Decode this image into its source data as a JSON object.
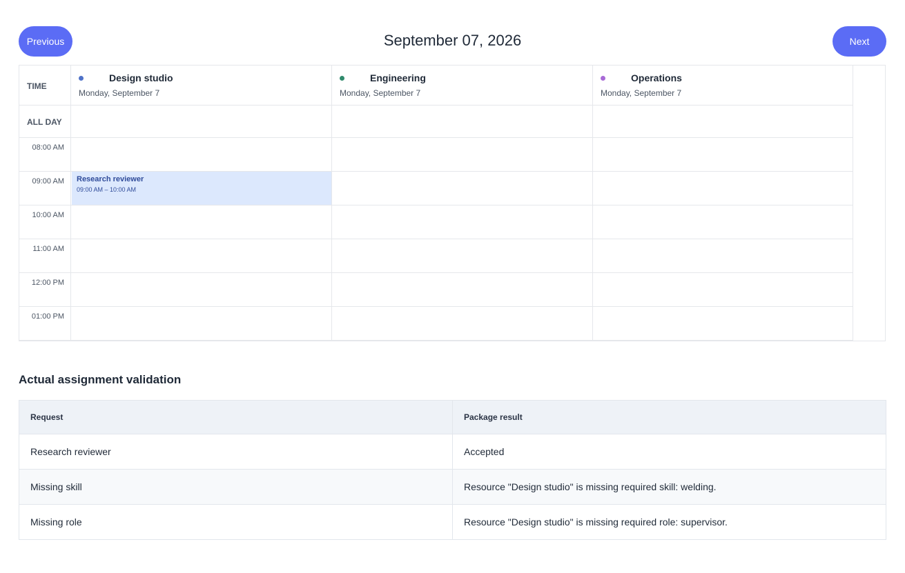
{
  "nav": {
    "previous_label": "Previous",
    "next_label": "Next",
    "current_date": "September 07, 2026"
  },
  "calendar": {
    "time_header": "TIME",
    "all_day_label": "ALL DAY",
    "resources": [
      {
        "name": "Design studio",
        "date": "Monday, September 7",
        "color": "#4f72c8"
      },
      {
        "name": "Engineering",
        "date": "Monday, September 7",
        "color": "#2f8a6c"
      },
      {
        "name": "Operations",
        "date": "Monday, September 7",
        "color": "#a86ad6"
      }
    ],
    "times": [
      "08:00 AM",
      "09:00 AM",
      "10:00 AM",
      "11:00 AM",
      "12:00 PM",
      "01:00 PM"
    ],
    "events": [
      {
        "title": "Research reviewer",
        "time": "09:00 AM – 10:00 AM",
        "resource": "Design studio",
        "start": "09:00 AM"
      }
    ]
  },
  "validation": {
    "title": "Actual assignment validation",
    "headers": {
      "request": "Request",
      "result": "Package result"
    },
    "rows": [
      {
        "request": "Research reviewer",
        "result": "Accepted"
      },
      {
        "request": "Missing skill",
        "result": "Resource \"Design studio\" is missing required skill: welding."
      },
      {
        "request": "Missing role",
        "result": "Resource \"Design studio\" is missing required role: supervisor."
      }
    ]
  }
}
